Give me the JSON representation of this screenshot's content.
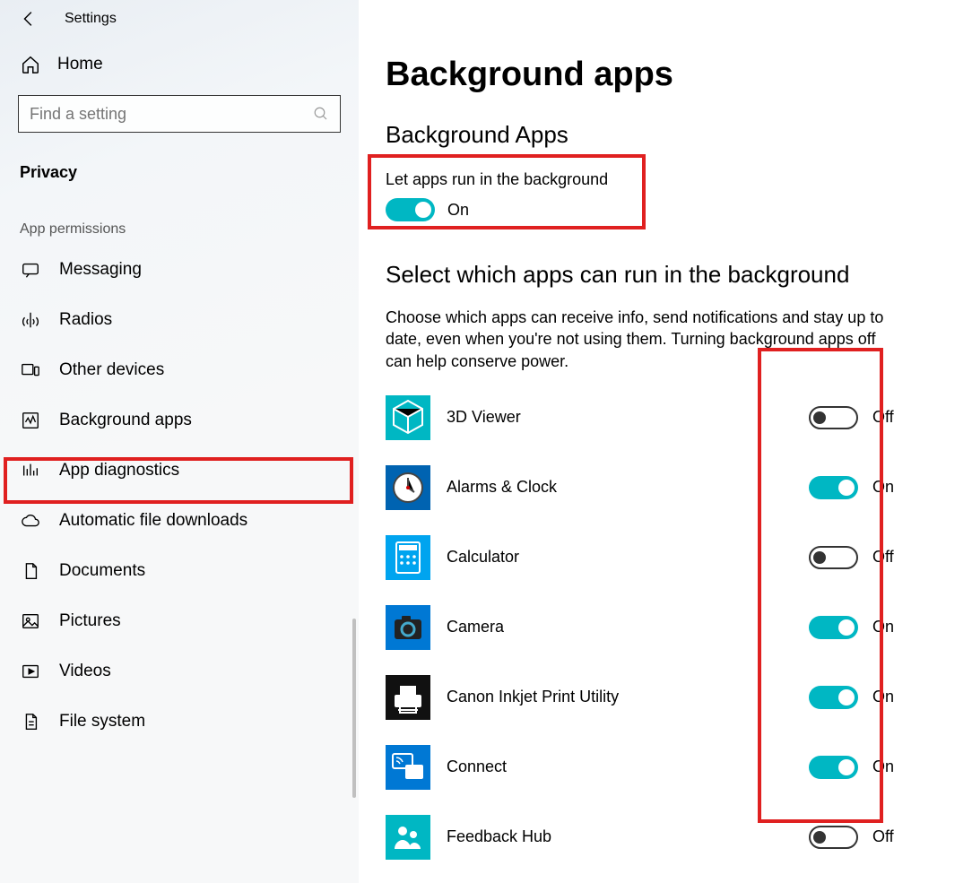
{
  "header": {
    "settings_label": "Settings",
    "home_label": "Home",
    "search_placeholder": "Find a setting",
    "privacy_label": "Privacy",
    "section_label": "App permissions"
  },
  "nav": [
    {
      "label": "Messaging",
      "icon": "message"
    },
    {
      "label": "Radios",
      "icon": "radio"
    },
    {
      "label": "Other devices",
      "icon": "devices"
    },
    {
      "label": "Background apps",
      "icon": "activity",
      "active": true
    },
    {
      "label": "App diagnostics",
      "icon": "diagnostics"
    },
    {
      "label": "Automatic file downloads",
      "icon": "cloud"
    },
    {
      "label": "Documents",
      "icon": "document"
    },
    {
      "label": "Pictures",
      "icon": "pictures"
    },
    {
      "label": "Videos",
      "icon": "videos"
    },
    {
      "label": "File system",
      "icon": "filesystem"
    }
  ],
  "main": {
    "title": "Background apps",
    "section1_heading": "Background Apps",
    "master_toggle_label": "Let apps run in the background",
    "master_toggle_on": true,
    "on_text": "On",
    "off_text": "Off",
    "section2_heading": "Select which apps can run in the background",
    "section2_desc": "Choose which apps can receive info, send notifications and stay up to date, even when you're not using them. Turning background apps off can help conserve power.",
    "apps": [
      {
        "name": "3D Viewer",
        "on": false,
        "bg": "#00b7c3",
        "icon": "cube"
      },
      {
        "name": "Alarms & Clock",
        "on": true,
        "bg": "#0063b1",
        "icon": "clock"
      },
      {
        "name": "Calculator",
        "on": false,
        "bg": "#00a4ef",
        "icon": "calc"
      },
      {
        "name": "Camera",
        "on": true,
        "bg": "#0078d4",
        "icon": "camera"
      },
      {
        "name": "Canon Inkjet Print Utility",
        "on": true,
        "bg": "#111111",
        "icon": "printer"
      },
      {
        "name": "Connect",
        "on": true,
        "bg": "#0078d4",
        "icon": "connect"
      },
      {
        "name": "Feedback Hub",
        "on": false,
        "bg": "#00b7c3",
        "icon": "people"
      }
    ]
  }
}
